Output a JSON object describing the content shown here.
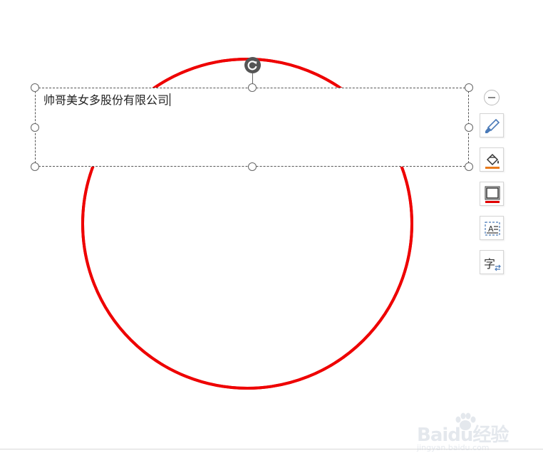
{
  "textbox": {
    "content": "帅哥美女多股份有限公司"
  },
  "shape": {
    "stroke_color": "#ee0000"
  },
  "float_toolbar": {
    "buttons": [
      {
        "name": "shape-style",
        "icon": "paintbrush-icon"
      },
      {
        "name": "fill",
        "icon": "fill-bucket-icon"
      },
      {
        "name": "outline",
        "icon": "outline-icon"
      },
      {
        "name": "text-wrap",
        "icon": "text-wrap-icon"
      },
      {
        "name": "text-direction",
        "icon": "text-direction-icon",
        "label": "字"
      }
    ]
  },
  "watermark": {
    "logo": "Baidu经验",
    "url": "jingyan.baidu.com"
  }
}
